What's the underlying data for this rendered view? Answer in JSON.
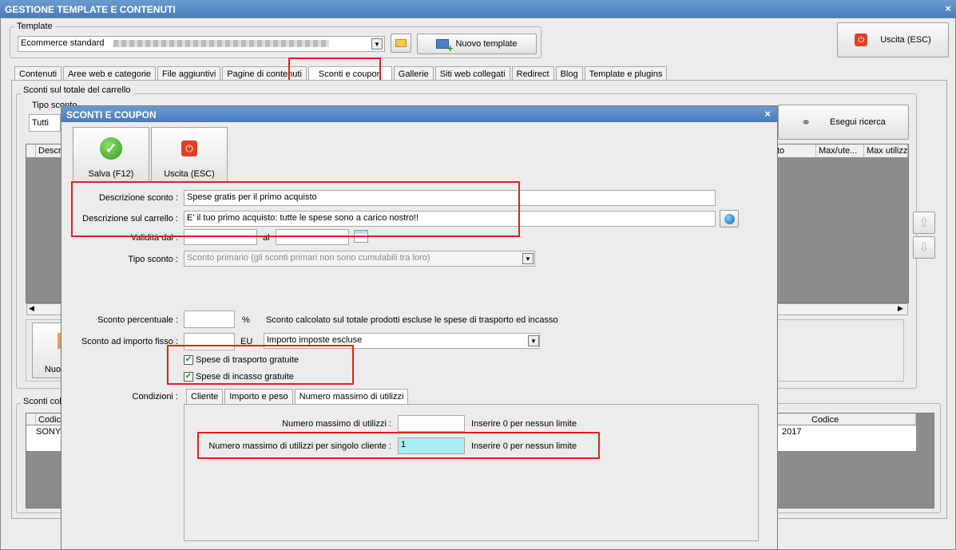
{
  "window": {
    "title": "GESTIONE TEMPLATE E CONTENUTI",
    "close": "×"
  },
  "template": {
    "group_label": "Template",
    "selected": "Ecommerce standard",
    "new_button": "Nuovo template",
    "exit_button": "Uscita (ESC)"
  },
  "tabs": [
    "Contenuti",
    "Aree web e categorie",
    "File aggiuntivi",
    "Pagine di contenuti",
    "Sconti e coupon",
    "Gallerie",
    "Siti web collegati",
    "Redirect",
    "Blog",
    "Template e plugins"
  ],
  "background": {
    "cart_group_label": "Sconti sul totale del carrello",
    "type_label": "Tipo sconto",
    "type_value": "Tutti",
    "search_button": "Esegui ricerca",
    "grid_headers": [
      "Descr",
      "to",
      "Max/ute...",
      "Max utilizz"
    ],
    "new_button": "Nuo",
    "coll_label": "Sconti coll",
    "grid2_headers": [
      "Codice",
      "Codice"
    ],
    "grid2_row": [
      "SONYF",
      "2017"
    ]
  },
  "modal": {
    "title": "SCONTI E COUPON",
    "close": "×",
    "save_label": "Salva (F12)",
    "exit_label": "Uscita (ESC)",
    "desc_label": "Descrizione sconto :",
    "desc_value": "Spese gratis per il primo acquisto",
    "cart_desc_label": "Descrizione sul carrello :",
    "cart_desc_value": "E' il tuo primo acquisto: tutte le spese sono a carico nostro!!",
    "validity_label": "Validità  dal :",
    "validity_to": "al",
    "type_label": "Tipo sconto :",
    "type_value": "Sconto primario (gli sconti primari non sono cumulabili tra loro)",
    "perc_label": "Sconto percentuale :",
    "perc_unit": "%",
    "perc_note": "Sconto calcolato sul totale prodotti escluse le spese di trasporto ed incasso",
    "fixed_label": "Sconto ad importo fisso :",
    "fixed_unit": "EU",
    "fixed_tax": "Importo imposte escluse",
    "cb_shipping": "Spese di trasporto gratuite",
    "cb_collection": "Spese di incasso gratuite",
    "conditions_label": "Condizioni :",
    "cond_tabs": [
      "Cliente",
      "Importo e peso",
      "Numero massimo di utilizzi"
    ],
    "max_uses_label": "Numero massimo di utilizzi :",
    "max_uses_value": "",
    "max_uses_note": "Inserire 0 per nessun limite",
    "max_per_client_label": "Numero massimo di utilizzi per singolo cliente :",
    "max_per_client_value": "1",
    "max_per_client_note": "Inserire 0 per nessun limite"
  }
}
